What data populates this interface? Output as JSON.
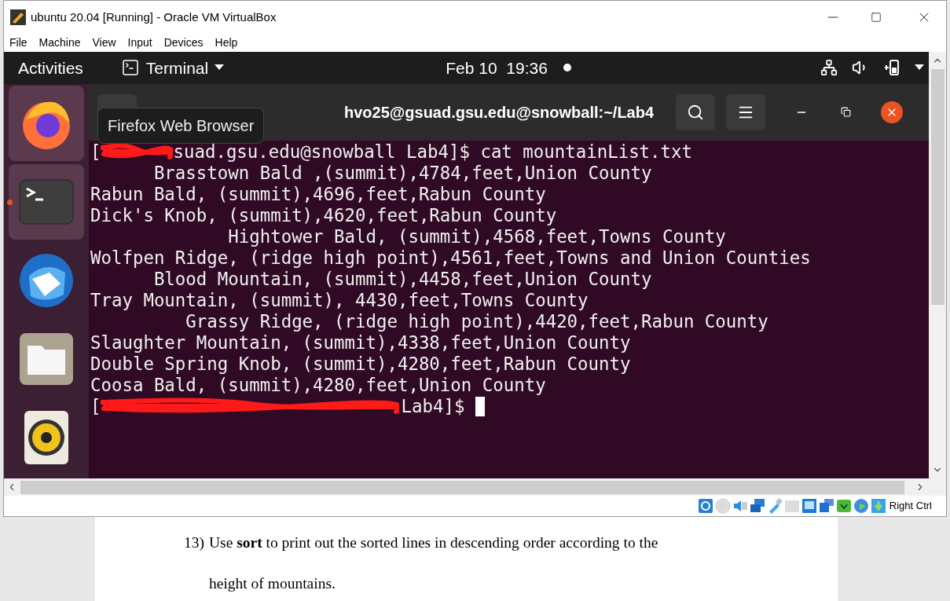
{
  "window": {
    "title": "ubuntu 20.04 [Running] - Oracle VM VirtualBox"
  },
  "menu": [
    "File",
    "Machine",
    "View",
    "Input",
    "Devices",
    "Help"
  ],
  "top_bar": {
    "activities": "Activities",
    "app_menu": "Terminal",
    "clock": "Feb 10  19:36"
  },
  "dock": {
    "items": [
      {
        "kind": "firefox",
        "highlighted": true,
        "running": false
      },
      {
        "kind": "terminal",
        "highlighted": true,
        "running": true
      },
      {
        "kind": "mail",
        "highlighted": false,
        "running": false
      },
      {
        "kind": "files",
        "highlighted": false,
        "running": false
      },
      {
        "kind": "music",
        "highlighted": false,
        "running": false
      }
    ],
    "tooltip": "Firefox Web Browser"
  },
  "terminal": {
    "title": "hvo25@gsuad.gsu.edu@snowball:~/Lab4",
    "lines": [
      {
        "kind": "prompt",
        "lead": "[",
        "text": "suad.gsu.edu@snowball Lab4]$ cat mountainList.txt"
      },
      {
        "kind": "output",
        "text": "      Brasstown Bald ,(summit),4784,feet,Union County"
      },
      {
        "kind": "output",
        "text": "Rabun Bald, (summit),4696,feet,Rabun County"
      },
      {
        "kind": "output",
        "text": "Dick's Knob, (summit),4620,feet,Rabun County"
      },
      {
        "kind": "output",
        "text": "             Hightower Bald, (summit),4568,feet,Towns County"
      },
      {
        "kind": "output",
        "text": "Wolfpen Ridge, (ridge high point),4561,feet,Towns and Union Counties"
      },
      {
        "kind": "output",
        "text": "      Blood Mountain, (summit),4458,feet,Union County"
      },
      {
        "kind": "output",
        "text": "Tray Mountain, (summit), 4430,feet,Towns County"
      },
      {
        "kind": "output",
        "text": "         Grassy Ridge, (ridge high point),4420,feet,Rabun County"
      },
      {
        "kind": "output",
        "text": "Slaughter Mountain, (summit),4338,feet,Union County"
      },
      {
        "kind": "output",
        "text": "Double Spring Knob, (summit),4280,feet,Rabun County"
      },
      {
        "kind": "output",
        "text": "Coosa Bald, (summit),4280,feet,Union County"
      },
      {
        "kind": "prompt_cursor",
        "lead": "[",
        "text": "Lab4]$"
      }
    ]
  },
  "status_bar": {
    "host_key": "Right Ctrl"
  },
  "document": {
    "number": "13)",
    "text": "Use **sort** to print out the sorted lines in descending order according to the",
    "continuation": "height of mountains."
  }
}
